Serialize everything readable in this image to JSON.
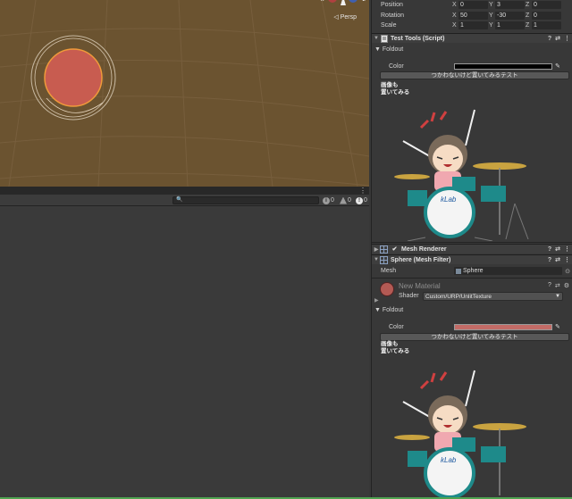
{
  "scene": {
    "projection_label": "◁ Persp",
    "gizmo_x": "x",
    "gizmo_z": "z",
    "colors": {
      "background": "#6b5330",
      "sphere": "#c85c50",
      "sphere_outline": "#f09a3a"
    }
  },
  "console": {
    "search_placeholder": "",
    "log_count": "0",
    "warning_count": "0",
    "error_count": "0"
  },
  "inspector": {
    "transform": {
      "position": {
        "label": "Position",
        "x": "0",
        "y": "3",
        "z": "0"
      },
      "rotation": {
        "label": "Rotation",
        "x": "50",
        "y": "-30",
        "z": "0"
      },
      "scale": {
        "label": "Scale",
        "x": "1",
        "y": "1",
        "z": "1"
      },
      "axis_x": "X",
      "axis_y": "Y",
      "axis_z": "Z"
    },
    "test_tools": {
      "title": "Test Tools (Script)",
      "foldout": "Foldout",
      "color_label": "Color",
      "color_value": "#000000",
      "button_label": "つかわないけど置いてみるテスト",
      "image_label_line1": "画像も",
      "image_label_line2": "置いてみる"
    },
    "mesh_renderer": {
      "title": "Mesh Renderer"
    },
    "mesh_filter": {
      "title": "Sphere (Mesh Filter)",
      "mesh_label": "Mesh",
      "mesh_value": "Sphere"
    },
    "material": {
      "name": "New Material",
      "shader_label": "Shader",
      "shader_value": "Custom/URP/UnlitTexture",
      "color": "#b35a54"
    },
    "material_tools": {
      "foldout": "Foldout",
      "color_label": "Color",
      "color_value": "#c36b66",
      "button_label": "つかわないけど置いてみるテスト",
      "image_label_line1": "画像も",
      "image_label_line2": "置いてみる"
    },
    "illustration_text": "kLab",
    "status_bar_color": "#4fa350"
  }
}
